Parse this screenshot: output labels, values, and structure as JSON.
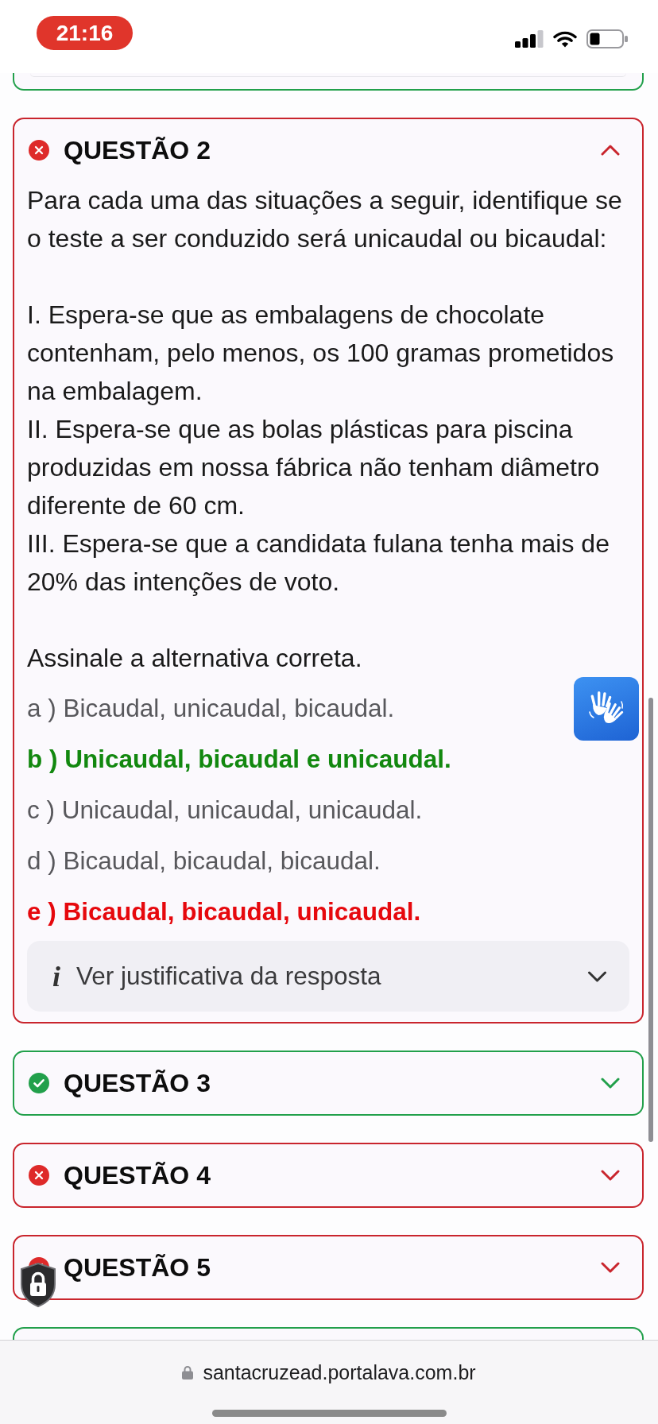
{
  "status_bar": {
    "time": "21:16"
  },
  "previous_question": {
    "correct": true
  },
  "questions": [
    {
      "title": "QUESTÃO 2",
      "correct": false,
      "expanded": true,
      "statement": {
        "intro": "Para cada uma das situações a seguir, identifique se o teste a ser conduzido será unicaudal ou bicaudal:",
        "items": [
          "I. Espera-se que as embalagens de chocolate contenham, pelo menos, os 100 gramas prometidos na embalagem.",
          "II. Espera-se que as bolas plásticas para piscina produzidas em nossa fábrica não tenham diâmetro diferente de 60 cm.",
          "III. Espera-se que a candidata fulana tenha mais de 20% das intenções de voto."
        ],
        "instruction": "Assinale a alternativa correta."
      },
      "options": [
        {
          "text": "a ) Bicaudal, unicaudal, bicaudal.",
          "kind": "plain"
        },
        {
          "text": "b ) Unicaudal, bicaudal e unicaudal.",
          "kind": "correct"
        },
        {
          "text": "c ) Unicaudal, unicaudal, unicaudal.",
          "kind": "plain"
        },
        {
          "text": "d ) Bicaudal, bicaudal, bicaudal.",
          "kind": "plain"
        },
        {
          "text": "e ) Bicaudal, bicaudal, unicaudal.",
          "kind": "wrong"
        }
      ],
      "justification": {
        "icon": "i",
        "label": "Ver justificativa da resposta",
        "expanded": false
      }
    },
    {
      "title": "QUESTÃO 3",
      "correct": true,
      "expanded": false
    },
    {
      "title": "QUESTÃO 4",
      "correct": false,
      "expanded": false
    },
    {
      "title": "QUESTÃO 5",
      "correct": false,
      "expanded": false
    }
  ],
  "next_question": {
    "correct": true
  },
  "browser": {
    "url": "santacruzead.portalava.com.br"
  }
}
